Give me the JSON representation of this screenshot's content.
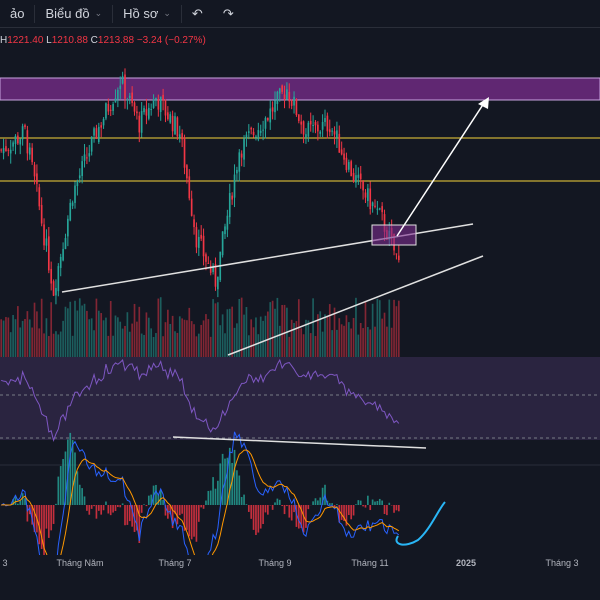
{
  "toolbar": {
    "items": [
      {
        "label": "ảo"
      },
      {
        "label": "Biểu đồ"
      },
      {
        "label": "Hồ sơ"
      }
    ],
    "undo": "undo-icon",
    "redo": "redo-icon"
  },
  "ohlc": {
    "h_label": "H",
    "h": "1221.40",
    "l_label": "L",
    "l": "1210.88",
    "c_label": "C",
    "c": "1213.88",
    "change": "−3.24 (−0.27%)"
  },
  "axis": {
    "labels": [
      "3",
      "Tháng Năm",
      "Tháng 7",
      "Tháng 9",
      "Tháng 11",
      "2025",
      "Tháng 3"
    ]
  },
  "colors": {
    "up": "#26a69a",
    "down": "#f23645",
    "zone": "#7b2d8e",
    "yellow": "#f5d33b",
    "rsi": "#7e57c2",
    "macd": "#2962ff",
    "signal": "#ff9800"
  },
  "price_anchors": [
    [
      0,
      1290
    ],
    [
      10,
      1300
    ],
    [
      15,
      1265
    ],
    [
      22,
      1210
    ],
    [
      30,
      1265
    ],
    [
      40,
      1300
    ],
    [
      50,
      1330
    ],
    [
      58,
      1305
    ],
    [
      65,
      1320
    ],
    [
      75,
      1300
    ],
    [
      82,
      1240
    ],
    [
      90,
      1215
    ],
    [
      100,
      1290
    ],
    [
      112,
      1310
    ],
    [
      120,
      1325
    ],
    [
      128,
      1300
    ],
    [
      138,
      1305
    ],
    [
      148,
      1275
    ],
    [
      160,
      1250
    ],
    [
      168,
      1222
    ]
  ]
}
